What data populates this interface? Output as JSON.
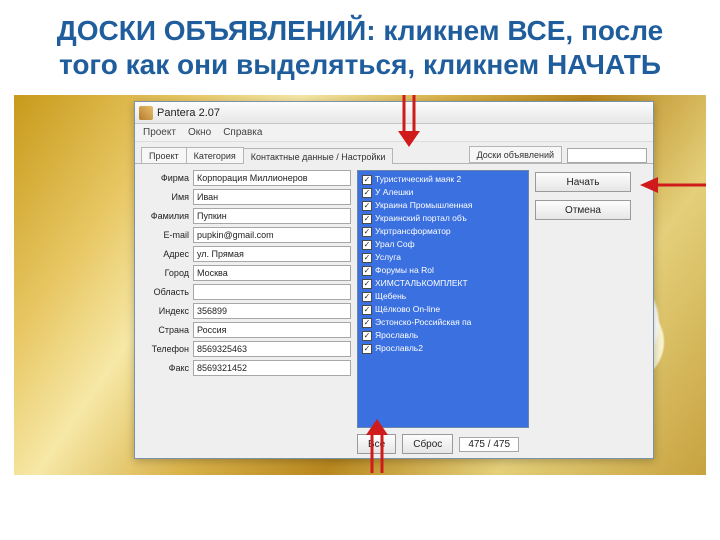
{
  "slide": {
    "title": "ДОСКИ ОБЪЯВЛЕНИЙ: кликнем ВСЕ, после того как они выделяться, кликнем НАЧАТЬ"
  },
  "window": {
    "title": "Pantera 2.07",
    "menu": {
      "project": "Проект",
      "window": "Окно",
      "help": "Справка"
    },
    "tabs": {
      "project": "Проект",
      "category": "Категория",
      "contacts": "Контактные данные / Настройки",
      "boards": "Доски объявлений"
    }
  },
  "form": {
    "labels": {
      "firm": "Фирма",
      "name": "Имя",
      "surname": "Фамилия",
      "email": "E-mail",
      "address": "Адрес",
      "city": "Город",
      "region": "Область",
      "index": "Индекс",
      "country": "Страна",
      "phone": "Телефон",
      "fax": "Факс"
    },
    "values": {
      "firm": "Корпорация Миллионеров",
      "name": "Иван",
      "surname": "Пупкин",
      "email": "pupkin@gmail.com",
      "address": "ул. Прямая",
      "city": "Москва",
      "region": "",
      "index": "356899",
      "country": "Россия",
      "phone": "8569325463",
      "fax": "8569321452"
    }
  },
  "list": {
    "items": [
      "Туристический маяк 2",
      "У Алешки",
      "Украина Промышленная",
      "Украинский портал объ",
      "Укртрансформатор",
      "Урал Соф",
      "Услуга",
      "Форумы на Rol",
      "ХИМСТАЛЬКОМПЛЕКТ",
      "Щебень",
      "Щёлково On-line",
      "Эстонско-Российская па",
      "Ярославль",
      "Ярославль2"
    ],
    "counter": "475 / 475"
  },
  "buttons": {
    "all": "Все",
    "reset": "Сброс",
    "start": "Начать",
    "cancel": "Отмена"
  }
}
